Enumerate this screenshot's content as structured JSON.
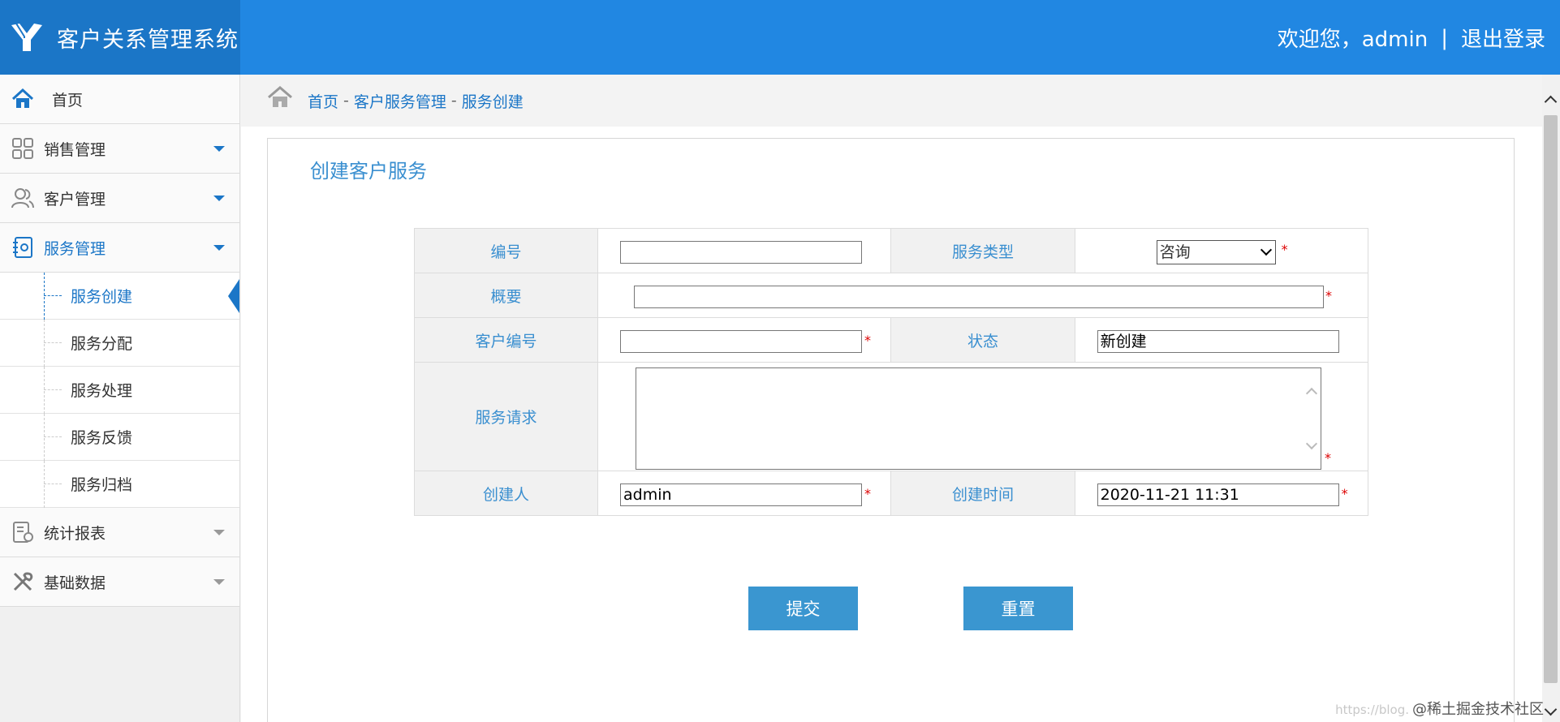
{
  "app": {
    "title": "客户关系管理系统"
  },
  "header": {
    "welcome": "欢迎您，admin",
    "separator": "|",
    "logout": "退出登录"
  },
  "sidebar": {
    "home": "首页",
    "sales": "销售管理",
    "customers": "客户管理",
    "service": "服务管理",
    "service_items": [
      "服务创建",
      "服务分配",
      "服务处理",
      "服务反馈",
      "服务归档"
    ],
    "reports": "统计报表",
    "basedata": "基础数据"
  },
  "breadcrumb": {
    "home": "首页",
    "sep": "-",
    "section": "客户服务管理",
    "page": "服务创建"
  },
  "form": {
    "title": "创建客户服务",
    "labels": {
      "id": "编号",
      "type": "服务类型",
      "summary": "概要",
      "customer_id": "客户编号",
      "status": "状态",
      "request": "服务请求",
      "creator": "创建人",
      "created_time": "创建时间"
    },
    "values": {
      "id": "",
      "type": "咨询",
      "summary": "",
      "customer_id": "",
      "status": "新创建",
      "request": "",
      "creator": "admin",
      "created_time": "2020-11-21 11:31"
    },
    "required_mark": "*",
    "buttons": {
      "submit": "提交",
      "reset": "重置"
    }
  },
  "watermark": {
    "faint": "https://blog.",
    "text": "@稀土掘金技术社区"
  },
  "colors": {
    "header": "#2187e2",
    "brand": "#1b76c7",
    "label": "#3a8fd0",
    "button": "#3a96d0",
    "required": "#dd0000"
  },
  "icons": [
    "logo-icon",
    "home-icon",
    "grid-icon",
    "users-icon",
    "contacts-icon",
    "report-icon",
    "tools-icon",
    "breadcrumb-home-icon"
  ]
}
